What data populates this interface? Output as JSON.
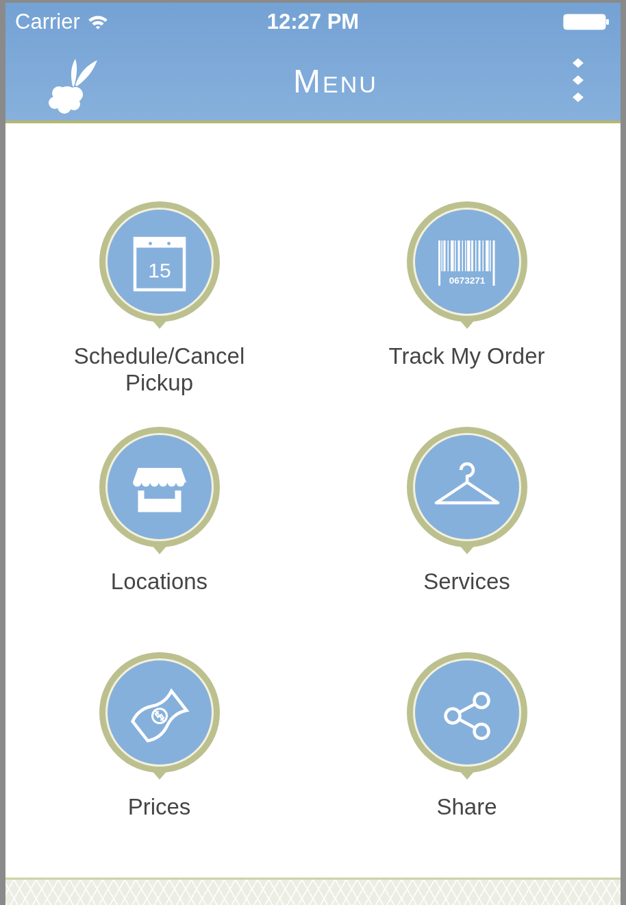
{
  "status_bar": {
    "carrier": "Carrier",
    "time": "12:27 PM"
  },
  "nav_bar": {
    "title": "Menu"
  },
  "menu_items": [
    {
      "label": "Schedule/Cancel Pickup",
      "kind": "calendar",
      "icon_text": "15"
    },
    {
      "label": "Track My Order",
      "kind": "barcode",
      "icon_text": "0673271"
    },
    {
      "label": "Locations",
      "kind": "store"
    },
    {
      "label": "Services",
      "kind": "hanger"
    },
    {
      "label": "Prices",
      "kind": "money"
    },
    {
      "label": "Share",
      "kind": "share"
    }
  ]
}
